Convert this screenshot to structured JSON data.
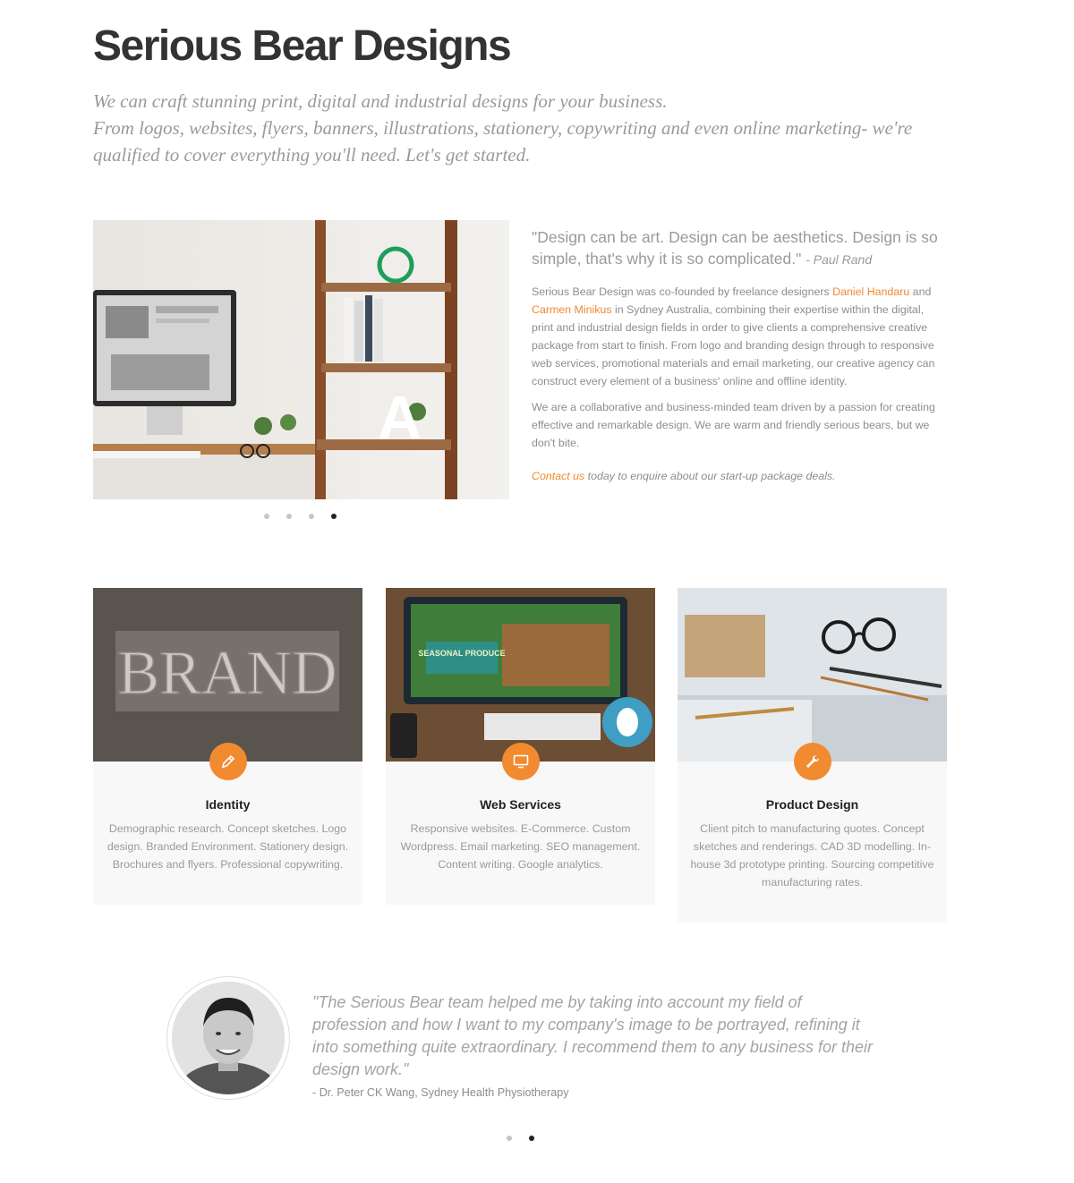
{
  "header": {
    "title": "Serious Bear Designs",
    "intro_lines": [
      "We can craft stunning print, digital and industrial designs for your business.",
      "From logos, websites, flyers, banners, illustrations, stationery, copywriting and even online marketing- we're qualified to cover everything you'll need. Let's get started."
    ]
  },
  "hero": {
    "image_letter": "A",
    "slider_dot_count": 4,
    "active_dot_index": 3
  },
  "about": {
    "quote": "\"Design can be art. Design can be aesthetics. Design is so simple, that's why it is so complicated.\"",
    "quote_author": "- Paul Rand",
    "p1_text_a": "Serious Bear Design was co-founded by freelance designers ",
    "p1_link_1": "Daniel Handaru",
    "p1_text_b": " and ",
    "p1_link_2": "Carmen Minikus",
    "p1_text_c": " in Sydney Australia, combining their expertise within the digital, print and industrial design fields in order to give clients a comprehensive creative package from start to finish. From logo and branding design through to responsive web services, promotional materials and email marketing, our creative agency can construct every element of a business' online and offline identity.",
    "p2": "We are a collaborative and business-minded team driven by a passion for creating effective and remarkable design. We are warm and friendly serious bears, but we don't bite.",
    "contact_link": "Contact us",
    "contact_rest": " today to enquire about our start-up package deals."
  },
  "services": [
    {
      "title": "Identity",
      "icon": "pencil-icon",
      "image_text": "BRAND",
      "description": "Demographic research. Concept sketches. Logo design. Branded Environment. Stationery design. Brochures and flyers. Professional copywriting."
    },
    {
      "title": "Web Services",
      "icon": "monitor-icon",
      "image_text": "SEASONAL PRODUCE",
      "description": "Responsive websites. E-Commerce. Custom Wordpress. Email marketing. SEO management. Content writing. Google analytics."
    },
    {
      "title": "Product Design",
      "icon": "wrench-icon",
      "description": "Client pitch to manufacturing quotes. Concept sketches and renderings. CAD 3D modelling. In-house 3d prototype printing. Sourcing competitive manufacturing rates."
    }
  ],
  "testimonial": {
    "quote": "\"The Serious Bear team helped me by taking into account my field of profession and how I want to my company's image to be portrayed, refining it into something quite extraordinary. I recommend them to any business for their design work.\"",
    "author": "- Dr. Peter CK Wang, Sydney Health Physiotherapy",
    "slider_dot_count": 2,
    "active_dot_index": 1
  },
  "colors": {
    "accent": "#f28a30",
    "text_muted": "#9a9a9a",
    "title": "#333333"
  }
}
